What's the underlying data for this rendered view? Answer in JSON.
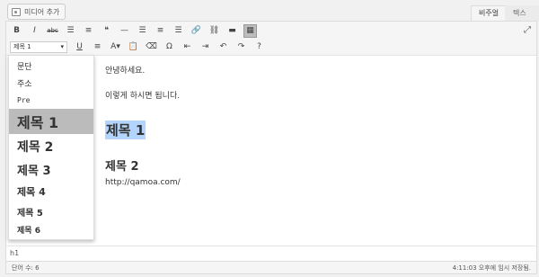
{
  "top": {
    "media_button": "미디어 추가",
    "tab_visual": "비주얼",
    "tab_text": "텍스트"
  },
  "toolbar": {
    "row1": [
      {
        "name": "bold-button",
        "glyph": "B"
      },
      {
        "name": "italic-button",
        "glyph": "I"
      },
      {
        "name": "strikethrough-button",
        "glyph": "abc"
      },
      {
        "name": "bullet-list-button",
        "glyph": "☰"
      },
      {
        "name": "numbered-list-button",
        "glyph": "≡"
      },
      {
        "name": "blockquote-button",
        "glyph": "❝"
      },
      {
        "name": "horizontal-line-button",
        "glyph": "—"
      },
      {
        "name": "align-left-button",
        "glyph": "☰"
      },
      {
        "name": "align-center-button",
        "glyph": "≡"
      },
      {
        "name": "align-right-button",
        "glyph": "☰"
      },
      {
        "name": "insert-link-button",
        "glyph": "🔗"
      },
      {
        "name": "remove-link-button",
        "glyph": "⛓"
      },
      {
        "name": "read-more-button",
        "glyph": "▬"
      },
      {
        "name": "toolbar-toggle-button",
        "glyph": "▦"
      }
    ],
    "format_select_value": "제목 1",
    "row2": [
      {
        "name": "underline-button",
        "glyph": "U"
      },
      {
        "name": "justify-button",
        "glyph": "≡"
      },
      {
        "name": "text-color-button",
        "glyph": "A▾"
      },
      {
        "name": "paste-as-text-button",
        "glyph": "📋"
      },
      {
        "name": "clear-formatting-button",
        "glyph": "⌫"
      },
      {
        "name": "special-character-button",
        "glyph": "Ω"
      },
      {
        "name": "outdent-button",
        "glyph": "⇤"
      },
      {
        "name": "indent-button",
        "glyph": "⇥"
      },
      {
        "name": "undo-button",
        "glyph": "↶"
      },
      {
        "name": "redo-button",
        "glyph": "↷"
      },
      {
        "name": "help-button",
        "glyph": "?"
      }
    ],
    "expand_glyph": "⤢"
  },
  "content": {
    "line1": "안녕하세요.",
    "line2": "이렇게 하시면 됩니다.",
    "heading1": "제목 1",
    "heading2": "제목 2",
    "url": "http://qamoa.com/"
  },
  "dropdown": {
    "items": [
      {
        "label": "문단"
      },
      {
        "label": "주소"
      },
      {
        "label": "Pre"
      },
      {
        "label": "제목 1"
      },
      {
        "label": "제목 2"
      },
      {
        "label": "제목 3"
      },
      {
        "label": "제목 4"
      },
      {
        "label": "제목 5"
      },
      {
        "label": "제목 6"
      }
    ],
    "selected_index": 3
  },
  "path": "h1",
  "status": {
    "word_count": "단어 수: 6",
    "saved": "4:11:03 오후에 임시 저장됨."
  }
}
